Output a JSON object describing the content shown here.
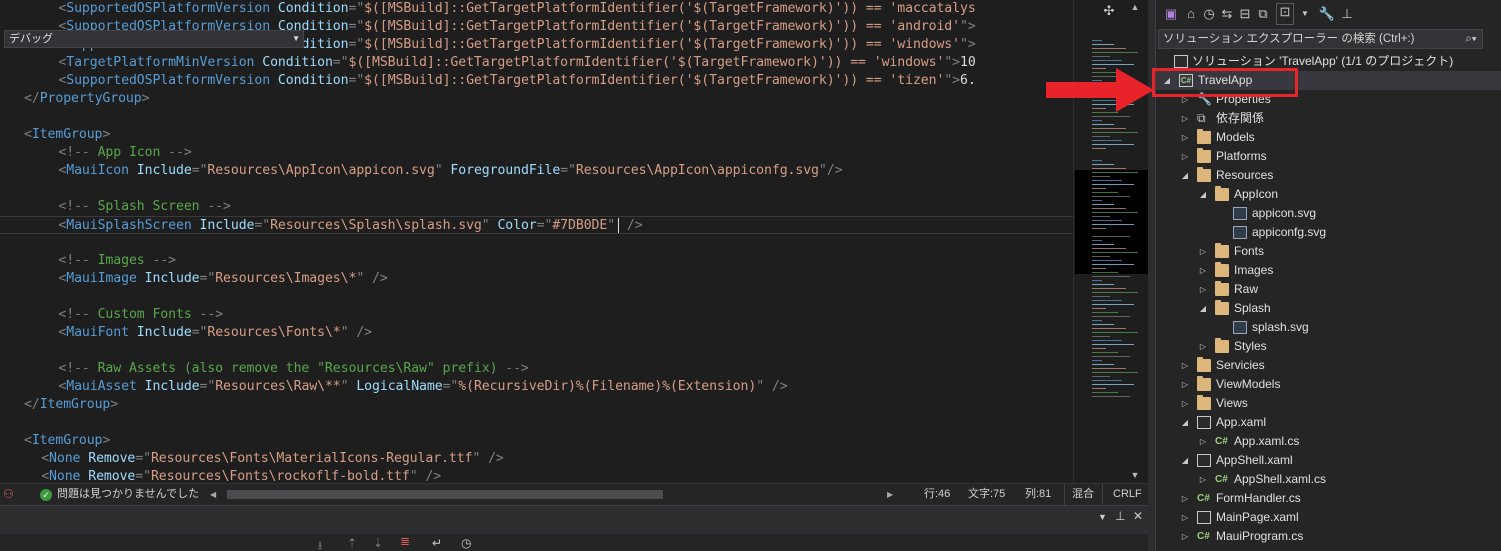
{
  "editor": {
    "lines": [
      {
        "indent": 4,
        "tokens": [
          [
            "b",
            "<"
          ],
          [
            "e",
            "SupportedOSPlatformVersion"
          ],
          [
            "p",
            " "
          ],
          [
            "a",
            "Condition"
          ],
          [
            "b",
            "=\""
          ],
          [
            "s",
            "$([MSBuild]::GetTargetPlatformIdentifier('$(TargetFramework)')) == 'maccatalys"
          ]
        ]
      },
      {
        "indent": 4,
        "tokens": [
          [
            "b",
            "<"
          ],
          [
            "e",
            "SupportedOSPlatformVersion"
          ],
          [
            "p",
            " "
          ],
          [
            "a",
            "Condition"
          ],
          [
            "b",
            "=\""
          ],
          [
            "s",
            "$([MSBuild]::GetTargetPlatformIdentifier('$(TargetFramework)')) == 'android'"
          ],
          [
            "b",
            "\">"
          ]
        ]
      },
      {
        "indent": 4,
        "tokens": [
          [
            "b",
            "<"
          ],
          [
            "e",
            "SupportedOSPlatformVersion"
          ],
          [
            "p",
            " "
          ],
          [
            "a",
            "Condition"
          ],
          [
            "b",
            "=\""
          ],
          [
            "s",
            "$([MSBuild]::GetTargetPlatformIdentifier('$(TargetFramework)')) == 'windows'"
          ],
          [
            "b",
            "\">"
          ]
        ]
      },
      {
        "indent": 4,
        "tokens": [
          [
            "b",
            "<"
          ],
          [
            "e",
            "TargetPlatformMinVersion"
          ],
          [
            "p",
            " "
          ],
          [
            "a",
            "Condition"
          ],
          [
            "b",
            "=\""
          ],
          [
            "s",
            "$([MSBuild]::GetTargetPlatformIdentifier('$(TargetFramework)')) == 'windows'"
          ],
          [
            "b",
            "\">"
          ],
          [
            "p",
            "10"
          ]
        ]
      },
      {
        "indent": 4,
        "tokens": [
          [
            "b",
            "<"
          ],
          [
            "e",
            "SupportedOSPlatformVersion"
          ],
          [
            "p",
            " "
          ],
          [
            "a",
            "Condition"
          ],
          [
            "b",
            "=\""
          ],
          [
            "s",
            "$([MSBuild]::GetTargetPlatformIdentifier('$(TargetFramework)')) == 'tizen'"
          ],
          [
            "b",
            "\">"
          ],
          [
            "p",
            "6."
          ]
        ]
      },
      {
        "indent": 0,
        "tokens": [
          [
            "b",
            "</"
          ],
          [
            "e",
            "PropertyGroup"
          ],
          [
            "b",
            ">"
          ]
        ]
      },
      {
        "indent": 0,
        "tokens": []
      },
      {
        "indent": 0,
        "tokens": [
          [
            "b",
            "<"
          ],
          [
            "e",
            "ItemGroup"
          ],
          [
            "b",
            ">"
          ]
        ]
      },
      {
        "indent": 4,
        "tokens": [
          [
            "b",
            "<!--"
          ],
          [
            "c",
            " App Icon "
          ],
          [
            "b",
            "-->"
          ]
        ]
      },
      {
        "indent": 4,
        "tokens": [
          [
            "b",
            "<"
          ],
          [
            "e",
            "MauiIcon"
          ],
          [
            "p",
            " "
          ],
          [
            "a",
            "Include"
          ],
          [
            "b",
            "=\""
          ],
          [
            "s",
            "Resources\\AppIcon\\appicon.svg"
          ],
          [
            "b",
            "\""
          ],
          [
            "p",
            " "
          ],
          [
            "a",
            "ForegroundFile"
          ],
          [
            "b",
            "=\""
          ],
          [
            "s",
            "Resources\\AppIcon\\appiconfg.svg"
          ],
          [
            "b",
            "\"/>"
          ]
        ]
      },
      {
        "indent": 0,
        "tokens": []
      },
      {
        "indent": 4,
        "tokens": [
          [
            "b",
            "<!--"
          ],
          [
            "c",
            " Splash Screen "
          ],
          [
            "b",
            "-->"
          ]
        ]
      },
      {
        "indent": 4,
        "current": true,
        "tokens": [
          [
            "b",
            "<"
          ],
          [
            "e",
            "MauiSplashScreen"
          ],
          [
            "p",
            " "
          ],
          [
            "a",
            "Include"
          ],
          [
            "b",
            "=\""
          ],
          [
            "s",
            "Resources\\Splash\\splash.svg"
          ],
          [
            "b",
            "\""
          ],
          [
            "p",
            " "
          ],
          [
            "a",
            "Color"
          ],
          [
            "b",
            "=\""
          ],
          [
            "s",
            "#7DB0DE"
          ],
          [
            "b",
            "\""
          ],
          [
            "cursor",
            ""
          ],
          [
            "b",
            " />"
          ]
        ]
      },
      {
        "indent": 0,
        "tokens": []
      },
      {
        "indent": 4,
        "tokens": [
          [
            "b",
            "<!--"
          ],
          [
            "c",
            " Images "
          ],
          [
            "b",
            "-->"
          ]
        ]
      },
      {
        "indent": 4,
        "tokens": [
          [
            "b",
            "<"
          ],
          [
            "e",
            "MauiImage"
          ],
          [
            "p",
            " "
          ],
          [
            "a",
            "Include"
          ],
          [
            "b",
            "=\""
          ],
          [
            "s",
            "Resources\\Images\\*"
          ],
          [
            "b",
            "\" />"
          ]
        ]
      },
      {
        "indent": 0,
        "tokens": []
      },
      {
        "indent": 4,
        "tokens": [
          [
            "b",
            "<!--"
          ],
          [
            "c",
            " Custom Fonts "
          ],
          [
            "b",
            "-->"
          ]
        ]
      },
      {
        "indent": 4,
        "tokens": [
          [
            "b",
            "<"
          ],
          [
            "e",
            "MauiFont"
          ],
          [
            "p",
            " "
          ],
          [
            "a",
            "Include"
          ],
          [
            "b",
            "=\""
          ],
          [
            "s",
            "Resources\\Fonts\\*"
          ],
          [
            "b",
            "\" />"
          ]
        ]
      },
      {
        "indent": 0,
        "tokens": []
      },
      {
        "indent": 4,
        "tokens": [
          [
            "b",
            "<!--"
          ],
          [
            "c",
            " Raw Assets (also remove the \"Resources\\Raw\" prefix) "
          ],
          [
            "b",
            "-->"
          ]
        ]
      },
      {
        "indent": 4,
        "tokens": [
          [
            "b",
            "<"
          ],
          [
            "e",
            "MauiAsset"
          ],
          [
            "p",
            " "
          ],
          [
            "a",
            "Include"
          ],
          [
            "b",
            "=\""
          ],
          [
            "s",
            "Resources\\Raw\\**"
          ],
          [
            "b",
            "\""
          ],
          [
            "p",
            " "
          ],
          [
            "a",
            "LogicalName"
          ],
          [
            "b",
            "=\""
          ],
          [
            "s",
            "%(RecursiveDir)%(Filename)%(Extension)"
          ],
          [
            "b",
            "\" />"
          ]
        ]
      },
      {
        "indent": 0,
        "tokens": [
          [
            "b",
            "</"
          ],
          [
            "e",
            "ItemGroup"
          ],
          [
            "b",
            ">"
          ]
        ]
      },
      {
        "indent": 0,
        "tokens": []
      },
      {
        "indent": 0,
        "tokens": [
          [
            "b",
            "<"
          ],
          [
            "e",
            "ItemGroup"
          ],
          [
            "b",
            ">"
          ]
        ]
      },
      {
        "indent": 2,
        "tokens": [
          [
            "b",
            "<"
          ],
          [
            "e",
            "None"
          ],
          [
            "p",
            " "
          ],
          [
            "a",
            "Remove"
          ],
          [
            "b",
            "=\""
          ],
          [
            "s",
            "Resources\\Fonts\\MaterialIcons-Regular.ttf"
          ],
          [
            "b",
            "\" />"
          ]
        ]
      },
      {
        "indent": 2,
        "tokens": [
          [
            "b",
            "<"
          ],
          [
            "e",
            "None"
          ],
          [
            "p",
            " "
          ],
          [
            "a",
            "Remove"
          ],
          [
            "b",
            "=\""
          ],
          [
            "s",
            "Resources\\Fonts\\rockoflf-bold.ttf"
          ],
          [
            "b",
            "\" />"
          ]
        ]
      }
    ]
  },
  "status": {
    "issues": "問題は見つかりませんでした",
    "line": "行:46",
    "char": "文字:75",
    "col": "列:81",
    "mixed": "混合",
    "eol": "CRLF"
  },
  "output": {
    "source": "デバッグ"
  },
  "solution_explorer": {
    "search_placeholder": "ソリューション エクスプローラー の検索 (Ctrl+:)",
    "solution_label": "ソリューション 'TravelApp' (1/1 のプロジェクト)",
    "items": [
      {
        "label": "TravelApp",
        "depth": 0,
        "twisty": "open",
        "icon": "project",
        "selected": true
      },
      {
        "label": "Properties",
        "depth": 1,
        "twisty": "closed",
        "icon": "wrench"
      },
      {
        "label": "依存関係",
        "depth": 1,
        "twisty": "closed",
        "icon": "deps"
      },
      {
        "label": "Models",
        "depth": 1,
        "twisty": "closed",
        "icon": "folder"
      },
      {
        "label": "Platforms",
        "depth": 1,
        "twisty": "closed",
        "icon": "folder"
      },
      {
        "label": "Resources",
        "depth": 1,
        "twisty": "open",
        "icon": "folder"
      },
      {
        "label": "AppIcon",
        "depth": 2,
        "twisty": "open",
        "icon": "folder"
      },
      {
        "label": "appicon.svg",
        "depth": 3,
        "twisty": "none",
        "icon": "svg"
      },
      {
        "label": "appiconfg.svg",
        "depth": 3,
        "twisty": "none",
        "icon": "svg"
      },
      {
        "label": "Fonts",
        "depth": 2,
        "twisty": "closed",
        "icon": "folder"
      },
      {
        "label": "Images",
        "depth": 2,
        "twisty": "closed",
        "icon": "folder"
      },
      {
        "label": "Raw",
        "depth": 2,
        "twisty": "closed",
        "icon": "folder"
      },
      {
        "label": "Splash",
        "depth": 2,
        "twisty": "open",
        "icon": "folder"
      },
      {
        "label": "splash.svg",
        "depth": 3,
        "twisty": "none",
        "icon": "svg"
      },
      {
        "label": "Styles",
        "depth": 2,
        "twisty": "closed",
        "icon": "folder"
      },
      {
        "label": "Servicies",
        "depth": 1,
        "twisty": "closed",
        "icon": "folder"
      },
      {
        "label": "ViewModels",
        "depth": 1,
        "twisty": "closed",
        "icon": "folder"
      },
      {
        "label": "Views",
        "depth": 1,
        "twisty": "closed",
        "icon": "folder"
      },
      {
        "label": "App.xaml",
        "depth": 1,
        "twisty": "open",
        "icon": "file"
      },
      {
        "label": "App.xaml.cs",
        "depth": 2,
        "twisty": "closed",
        "icon": "cs"
      },
      {
        "label": "AppShell.xaml",
        "depth": 1,
        "twisty": "open",
        "icon": "file"
      },
      {
        "label": "AppShell.xaml.cs",
        "depth": 2,
        "twisty": "closed",
        "icon": "cs"
      },
      {
        "label": "FormHandler.cs",
        "depth": 1,
        "twisty": "closed",
        "icon": "cs"
      },
      {
        "label": "MainPage.xaml",
        "depth": 1,
        "twisty": "closed",
        "icon": "file"
      },
      {
        "label": "MauiProgram.cs",
        "depth": 1,
        "twisty": "closed",
        "icon": "cs"
      }
    ]
  },
  "colors": {
    "highlight": "#e8232a",
    "xml_element": "#569cd6",
    "xml_attribute": "#9cdcfe",
    "xml_string": "#d69d85",
    "xml_comment": "#57a64a"
  }
}
